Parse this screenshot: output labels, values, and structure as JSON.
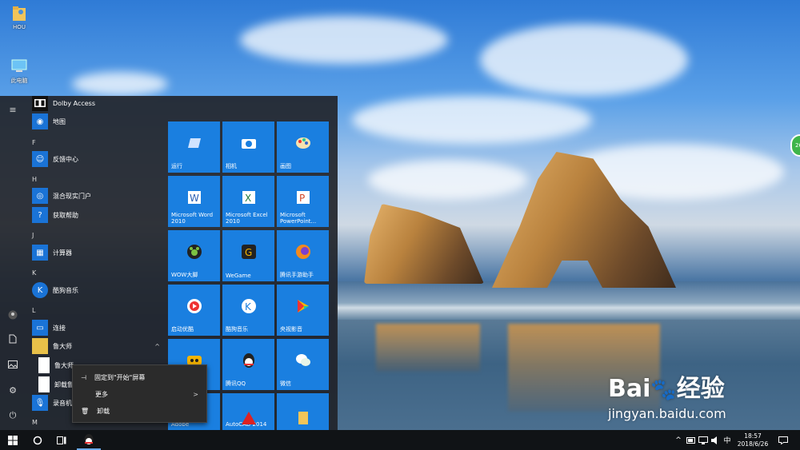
{
  "desktop": {
    "icons": [
      {
        "label": "HOU",
        "icon": "user-folder-icon"
      },
      {
        "label": "此电脑",
        "icon": "this-pc-icon"
      }
    ],
    "edge_badge": "26"
  },
  "start_menu": {
    "rail": [
      "hamburger-icon",
      "user-icon",
      "document-icon",
      "pictures-icon",
      "settings-icon",
      "power-icon"
    ],
    "apps": [
      {
        "type": "app",
        "label": "Dolby Access",
        "icon": "dolby-icon"
      },
      {
        "type": "app",
        "label": "地图",
        "icon": "map-icon"
      },
      {
        "type": "letter",
        "label": "F"
      },
      {
        "type": "app",
        "label": "反馈中心",
        "icon": "feedback-icon"
      },
      {
        "type": "letter",
        "label": "H"
      },
      {
        "type": "app",
        "label": "混合现实门户",
        "icon": "mixed-reality-icon"
      },
      {
        "type": "app",
        "label": "获取帮助",
        "icon": "help-icon"
      },
      {
        "type": "letter",
        "label": "J"
      },
      {
        "type": "app",
        "label": "计算器",
        "icon": "calculator-icon"
      },
      {
        "type": "letter",
        "label": "K"
      },
      {
        "type": "app",
        "label": "酷狗音乐",
        "icon": "kugou-icon"
      },
      {
        "type": "letter",
        "label": "L"
      },
      {
        "type": "app",
        "label": "连接",
        "icon": "connect-icon"
      },
      {
        "type": "app",
        "label": "鲁大师",
        "icon": "folder-icon"
      },
      {
        "type": "app",
        "label": "鲁大师",
        "icon": "file-icon"
      },
      {
        "type": "app",
        "label": "卸载鲁",
        "icon": "file-icon"
      },
      {
        "type": "app",
        "label": "录音机",
        "icon": "mic-icon"
      },
      {
        "type": "letter",
        "label": "M"
      }
    ],
    "tiles": [
      {
        "label": "运行",
        "icon": "run-icon"
      },
      {
        "label": "相机",
        "icon": "camera-icon"
      },
      {
        "label": "画图",
        "icon": "paint-icon"
      },
      {
        "label": "Microsoft Word 2010",
        "icon": "word-icon"
      },
      {
        "label": "Microsoft Excel 2010",
        "icon": "excel-icon"
      },
      {
        "label": "Microsoft PowerPoint...",
        "icon": "powerpoint-icon"
      },
      {
        "label": "WOW大脚",
        "icon": "wow-icon"
      },
      {
        "label": "WeGame",
        "icon": "wegame-icon"
      },
      {
        "label": "腾讯手游助手",
        "icon": "tencent-game-icon"
      },
      {
        "label": "启动优酷",
        "icon": "youku-icon"
      },
      {
        "label": "酷狗音乐",
        "icon": "kugou-icon"
      },
      {
        "label": "央视影音",
        "icon": "cctv-icon"
      },
      {
        "label": "",
        "icon": "app-icon"
      },
      {
        "label": "腾讯QQ",
        "icon": "qq-icon"
      },
      {
        "label": "微信",
        "icon": "wechat-icon"
      },
      {
        "label": "Adobe",
        "icon": "adobe-icon"
      },
      {
        "label": "AutoCAD 2014",
        "icon": "autocad-icon"
      },
      {
        "label": "",
        "icon": "folder-icon"
      }
    ]
  },
  "context_menu": {
    "items": [
      {
        "label": "固定到\"开始\"屏幕",
        "icon": "pin-icon"
      },
      {
        "label": "更多",
        "icon": "",
        "submenu": ">"
      },
      {
        "label": "卸载",
        "icon": "trash-icon"
      }
    ]
  },
  "taskbar": {
    "ime": "中",
    "time": "18:57",
    "date": "2018/6/26"
  },
  "watermark": {
    "brand": "Bai",
    "brand2": "经验",
    "url": "jingyan.baidu.com"
  }
}
